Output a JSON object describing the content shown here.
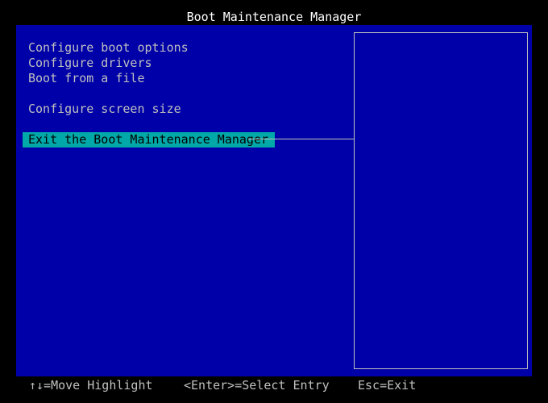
{
  "title": "Boot Maintenance Manager",
  "menu": {
    "items": [
      {
        "label": "Configure boot options"
      },
      {
        "label": "Configure drivers"
      },
      {
        "label": "Boot from a file"
      },
      {
        "label": "Configure screen size"
      },
      {
        "label": "Exit the Boot Maintenance Manager",
        "selected": true
      }
    ]
  },
  "help": {
    "text": ""
  },
  "footer": {
    "move_hint": "↑↓=Move Highlight",
    "enter_hint": "<Enter>=Select Entry",
    "esc_hint": "Esc=Exit"
  },
  "colors": {
    "background": "#0000a8",
    "screen": "#000000",
    "text": "#c0c0c0",
    "title": "#ffffff",
    "highlight": "#00a8a8",
    "highlight_text": "#000000"
  }
}
